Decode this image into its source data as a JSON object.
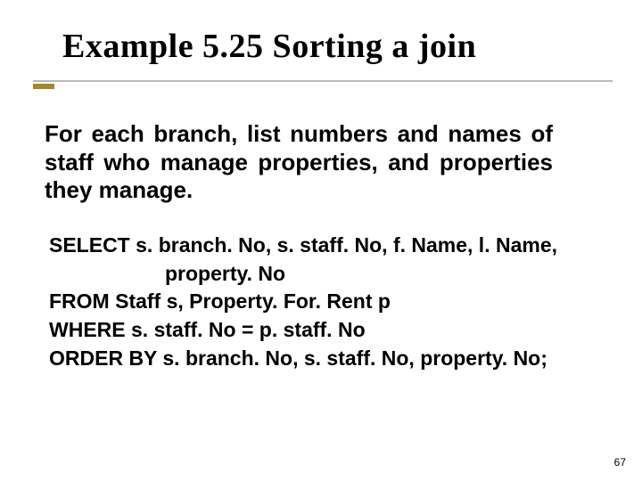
{
  "title": "Example 5.25  Sorting a join",
  "problem": "For each branch, list numbers and names of staff who manage properties, and properties they manage.",
  "sql": {
    "select": "SELECT s. branch. No, s. staff. No, f. Name, l. Name,",
    "select_cont": "property. No",
    "from": "FROM Staff s, Property. For. Rent p",
    "where": "WHERE s. staff. No = p. staff. No",
    "orderby": "ORDER BY s. branch. No, s. staff. No, property. No;"
  },
  "page_number": "67"
}
